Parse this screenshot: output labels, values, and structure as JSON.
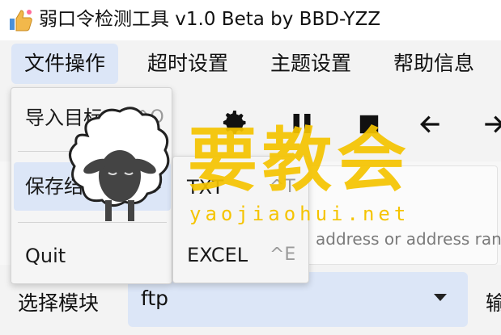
{
  "window": {
    "title": "弱口令检测工具 v1.0 Beta by BBD-YZZ",
    "icon": "thumbs-up-app-icon"
  },
  "menubar": {
    "items": [
      {
        "label": "文件操作",
        "active": true
      },
      {
        "label": "超时设置",
        "active": false
      },
      {
        "label": "主题设置",
        "active": false
      },
      {
        "label": "帮助信息",
        "active": false
      }
    ]
  },
  "file_menu": {
    "items": [
      {
        "label": "导入目标",
        "shortcut": "^O"
      },
      {
        "label": "保存结果",
        "has_submenu": true
      },
      {
        "label": "Quit",
        "shortcut": ""
      }
    ]
  },
  "save_submenu": {
    "items": [
      {
        "label": "TXT",
        "shortcut": "^T"
      },
      {
        "label": "EXCEL",
        "shortcut": "^E"
      }
    ]
  },
  "toolbar": {
    "icons": [
      "gear-icon",
      "pause-icon",
      "stop-icon",
      "arrow-left-icon",
      "arrow-right-icon"
    ]
  },
  "target_input": {
    "placeholder": "address or address ran"
  },
  "module": {
    "label": "选择模块",
    "value": "ftp",
    "next_label_partial": "输"
  },
  "watermark": {
    "title": "要教会",
    "url": "yaojiaohui.net",
    "color": "#f5c400"
  },
  "colors": {
    "accent": "#dce6f7",
    "background": "#f3f3f3"
  }
}
